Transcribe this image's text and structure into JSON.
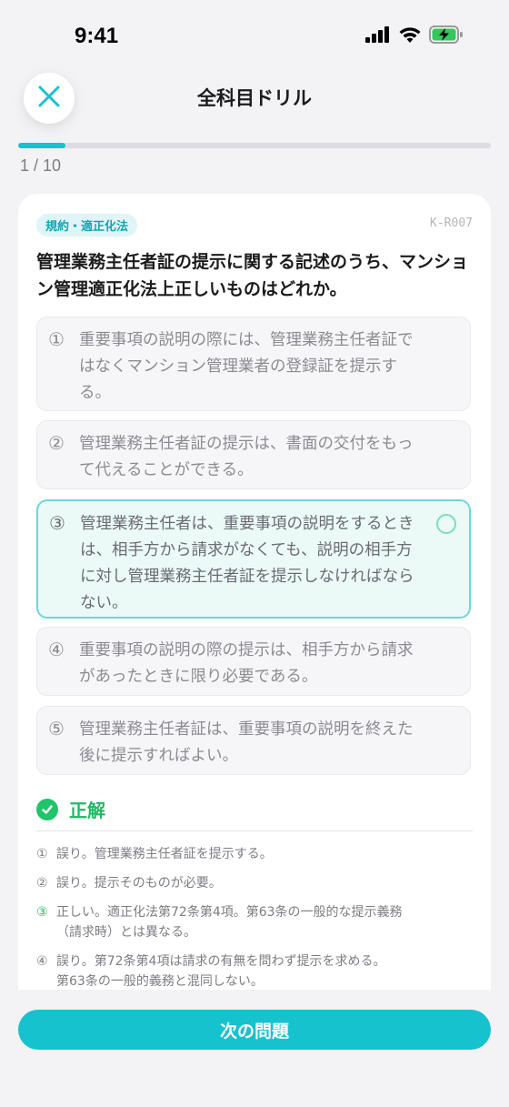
{
  "status_bar": {
    "time": "9:41",
    "icons": [
      "cellular-signal-icon",
      "wifi-icon",
      "battery-charging-icon"
    ]
  },
  "header": {
    "title": "全科目ドリル",
    "close_icon": "close-icon"
  },
  "progress": {
    "text": "1 / 10",
    "current": 1,
    "total": 10,
    "fraction": 0.1
  },
  "question": {
    "tag": "規約・適正化法",
    "id": "K-R007",
    "text": "管理業務主任者証の提示に関する記述のうち、マンション管理適正化法上正しいものはどれか。",
    "options": [
      {
        "num": "①",
        "text": "重要事項の説明の際には、管理業務主任者証ではなくマンション管理業者の登録証を提示する。"
      },
      {
        "num": "②",
        "text": "管理業務主任者証の提示は、書面の交付をもって代えることができる。"
      },
      {
        "num": "③",
        "text": "管理業務主任者は、重要事項の説明をするときは、相手方から請求がなくても、説明の相手方に対し管理業務主任者証を提示しなければならない。",
        "selected": true
      },
      {
        "num": "④",
        "text": "重要事項の説明の際の提示は、相手方から請求があったときに限り必要である。"
      },
      {
        "num": "⑤",
        "text": "管理業務主任者証は、重要事項の説明を終えた後に提示すればよい。"
      }
    ]
  },
  "result": {
    "label": "正解",
    "icon": "check-circle-icon",
    "color": "#20b864"
  },
  "explanations": [
    {
      "num": "①",
      "line1": "誤り。管理業務主任者証を提示する。",
      "line2": ""
    },
    {
      "num": "②",
      "line1": "誤り。提示そのものが必要。",
      "line2": ""
    },
    {
      "num": "③",
      "line1": "正しい。適正化法第72条第4項。第63条の一般的な提示義務",
      "line2": "（請求時）とは異なる。"
    },
    {
      "num": "④",
      "line1": "誤り。第72条第4項は請求の有無を問わず提示を求める。",
      "line2": "第63条の一般的義務と混同しない。"
    }
  ],
  "footer": {
    "next_label": "次の問題"
  },
  "colors": {
    "accent": "#17c2cf",
    "correct": "#20b864"
  }
}
